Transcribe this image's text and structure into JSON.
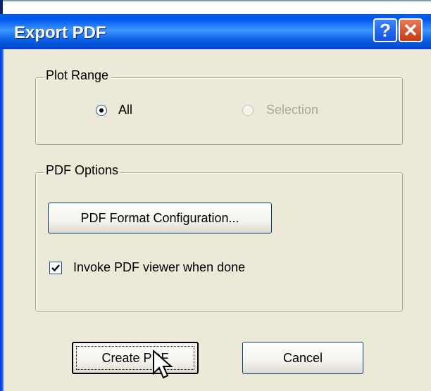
{
  "dialog": {
    "title": "Export PDF",
    "help_glyph": "?",
    "close_glyph": "✕"
  },
  "plot_range": {
    "legend": "Plot Range",
    "options": [
      {
        "label": "All",
        "selected": true,
        "enabled": true
      },
      {
        "label": "Selection",
        "selected": false,
        "enabled": false
      }
    ]
  },
  "pdf_options": {
    "legend": "PDF Options",
    "config_button": "PDF Format Configuration...",
    "invoke_viewer": {
      "label": "Invoke PDF viewer when done",
      "checked": true
    }
  },
  "footer": {
    "create_button": "Create PDF",
    "cancel_button": "Cancel"
  },
  "colors": {
    "title_bar": "#0a5fe3",
    "dialog_bg": "#ECE9D8",
    "close_button": "#c63a14"
  }
}
